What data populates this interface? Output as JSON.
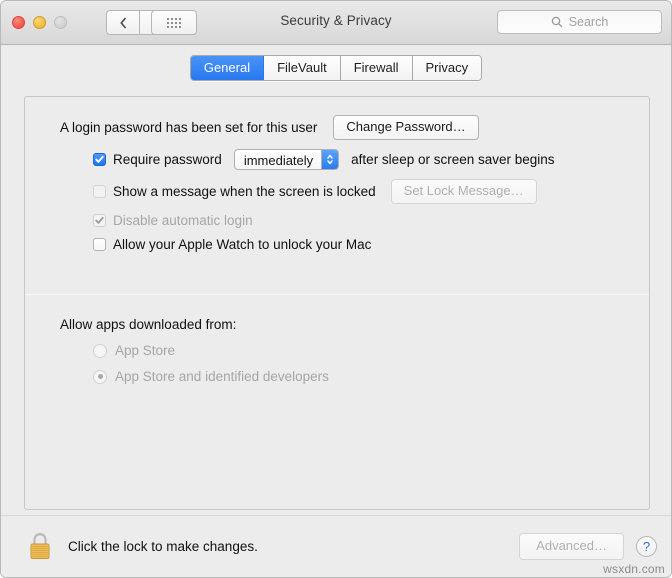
{
  "window": {
    "title": "Security & Privacy",
    "traffic_lights": [
      "close",
      "minimize",
      "zoom"
    ],
    "nav": {
      "back_label": "back",
      "forward_label": "forward"
    },
    "show_all_label": "Show All",
    "search": {
      "placeholder": "Search",
      "value": ""
    }
  },
  "tabs": [
    {
      "label": "General",
      "active": true
    },
    {
      "label": "FileVault",
      "active": false
    },
    {
      "label": "Firewall",
      "active": false
    },
    {
      "label": "Privacy",
      "active": false
    }
  ],
  "general": {
    "login_password_text": "A login password has been set for this user",
    "change_password_button": "Change Password…",
    "require_password": {
      "label": "Require password",
      "checked": true,
      "delay_value": "immediately",
      "suffix": "after sleep or screen saver begins"
    },
    "lock_message": {
      "label": "Show a message when the screen is locked",
      "checked": false,
      "enabled": false,
      "button": "Set Lock Message…"
    },
    "disable_auto_login": {
      "label": "Disable automatic login",
      "checked": true,
      "enabled": false
    },
    "apple_watch": {
      "label": "Allow your Apple Watch to unlock your Mac",
      "checked": false,
      "enabled": true
    },
    "allow_apps": {
      "title": "Allow apps downloaded from:",
      "options": [
        {
          "label": "App Store",
          "selected": false
        },
        {
          "label": "App Store and identified developers",
          "selected": true
        }
      ]
    }
  },
  "bottom": {
    "lock_state": "locked",
    "lock_text": "Click the lock to make changes.",
    "advanced_button": "Advanced…",
    "help_button": "?"
  },
  "watermark": "wsxdn.com",
  "colors": {
    "accent_blue": "#2878ef",
    "lock_gold": "#efb949",
    "window_bg": "#ececec"
  }
}
